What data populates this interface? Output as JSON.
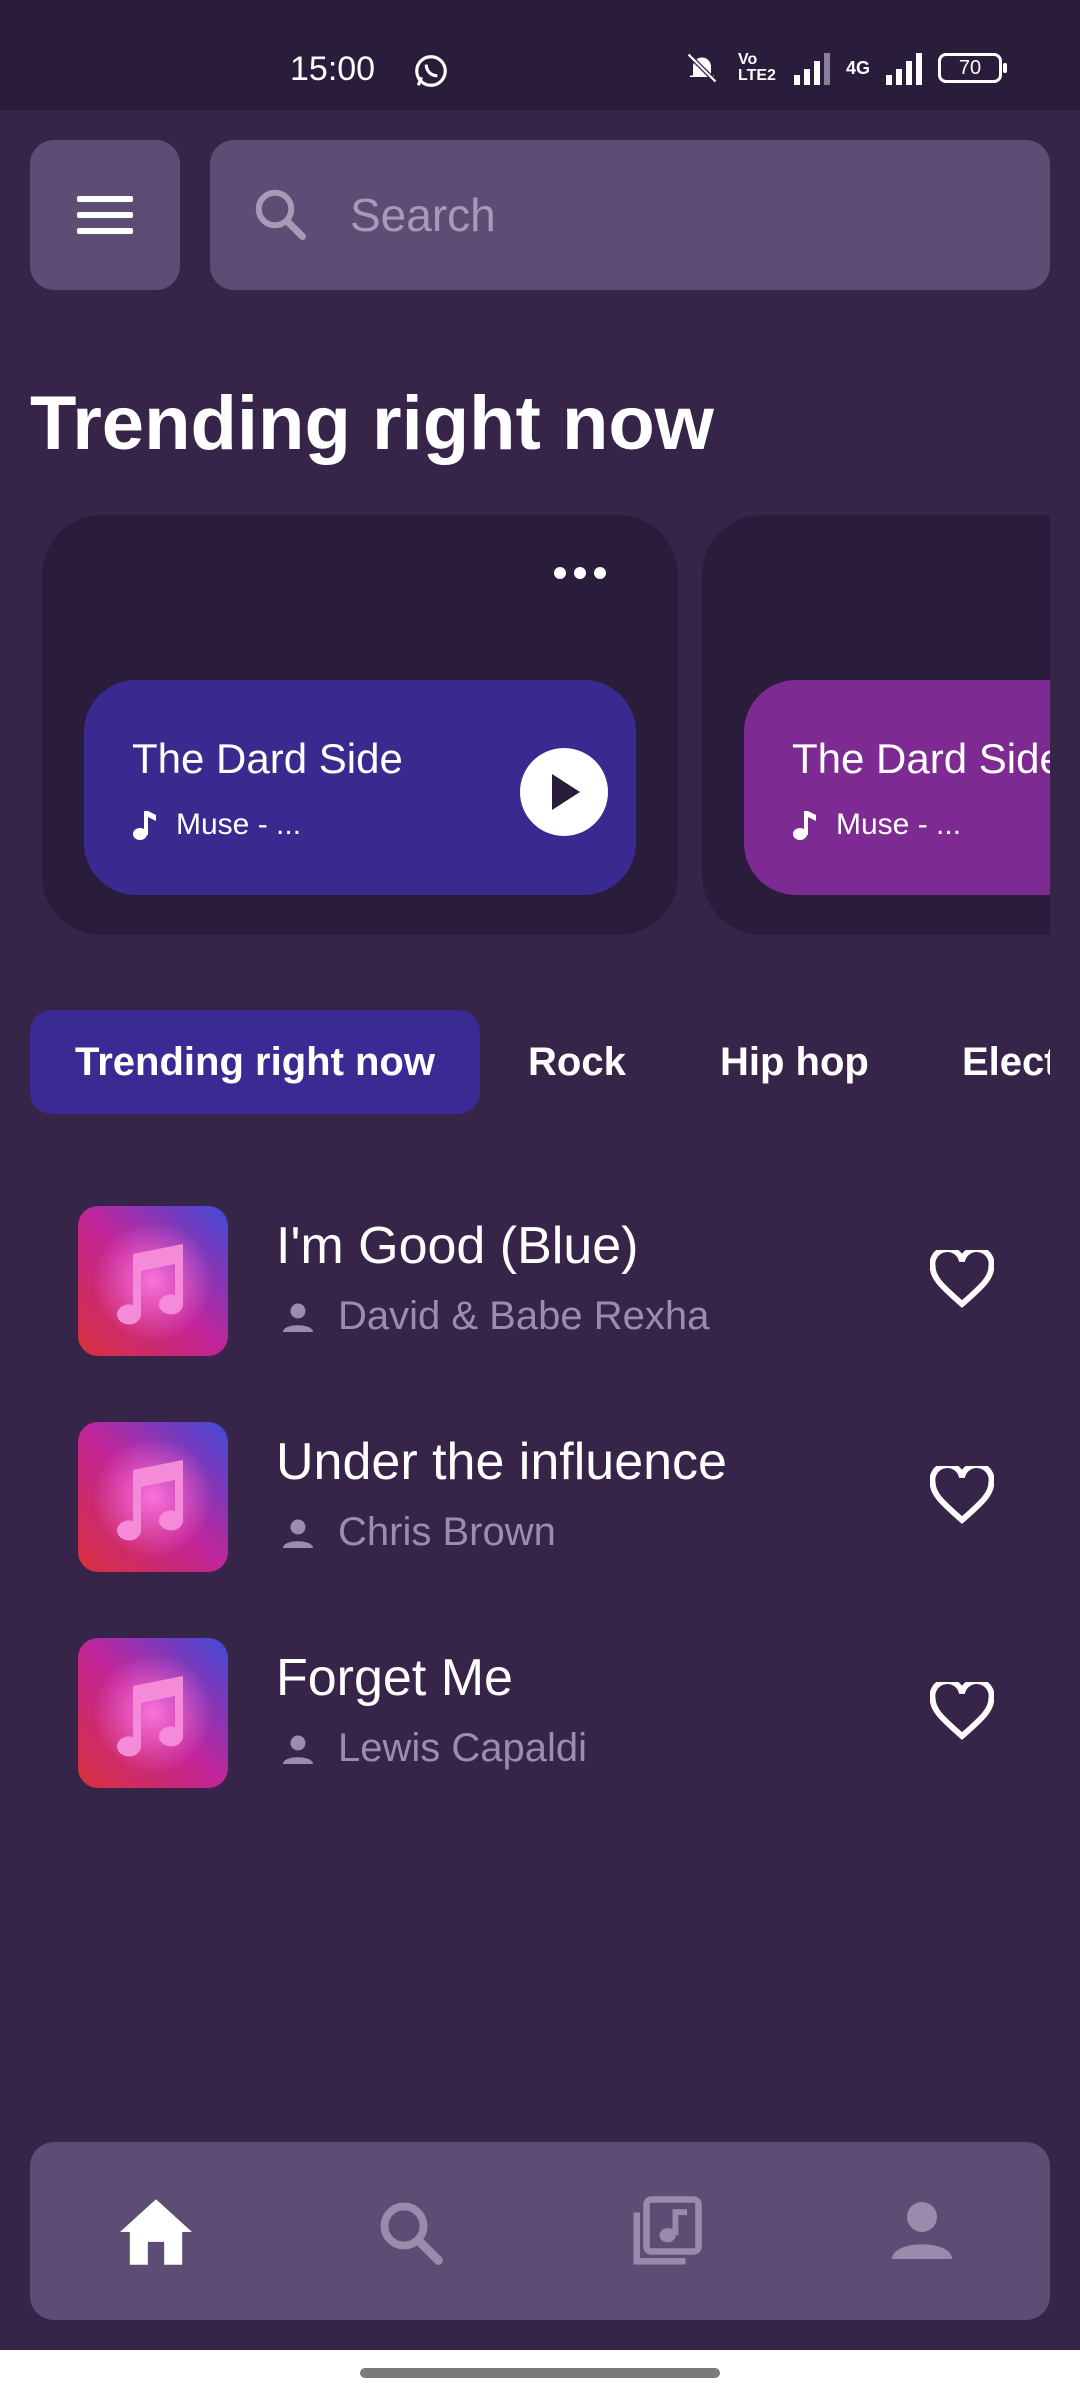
{
  "status_bar": {
    "time": "15:00",
    "network_label": "Vo LTE2",
    "signal_label": "4G",
    "battery": "70"
  },
  "top": {
    "menu_icon": "hamburger-icon",
    "search_icon": "search-icon",
    "search_placeholder": "Search"
  },
  "section_title": "Trending right now",
  "featured": [
    {
      "title": "The Dard Side",
      "subtitle": "Muse - ...",
      "color": "#3a2a8f"
    },
    {
      "title": "The Dard Side",
      "subtitle": "Muse - ...",
      "color": "#7d2b92"
    }
  ],
  "genres": [
    "Trending right now",
    "Rock",
    "Hip hop",
    "Elect"
  ],
  "songs": [
    {
      "title": "I'm Good (Blue)",
      "artist": "David & Babe Rexha"
    },
    {
      "title": "Under the influence",
      "artist": "Chris Brown"
    },
    {
      "title": "Forget Me",
      "artist": "Lewis Capaldi"
    }
  ],
  "bottom_nav": [
    {
      "icon": "home-icon",
      "active": true
    },
    {
      "icon": "search-icon",
      "active": false
    },
    {
      "icon": "library-music-icon",
      "active": false
    },
    {
      "icon": "person-icon",
      "active": false
    }
  ],
  "colors": {
    "background": "#372549",
    "surface": "#5d4c73",
    "card": "#2a1c3b",
    "accent": "#3b2a93",
    "muted_text": "#9c8caf"
  }
}
